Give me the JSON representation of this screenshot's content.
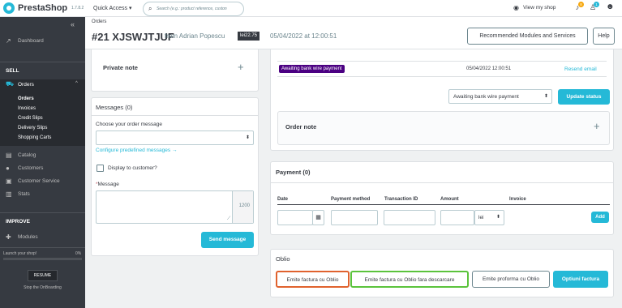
{
  "topbar": {
    "logo": "PrestaShop",
    "version": "1.7.8.2",
    "quick_access": "Quick Access ▾",
    "search_placeholder": "Search (e.g.: product reference, custon",
    "view_shop": "View my shop",
    "badge_orders": "8",
    "badge_customers": "1"
  },
  "sidebar": {
    "dashboard": "Dashboard",
    "sell": "SELL",
    "orders": "Orders",
    "orders_sub": [
      "Orders",
      "Invoices",
      "Credit Slips",
      "Delivery Slips",
      "Shopping Carts"
    ],
    "catalog": "Catalog",
    "customers": "Customers",
    "customer_service": "Customer Service",
    "stats": "Stats",
    "improve": "IMPROVE",
    "modules": "Modules",
    "launch": "Launch your shop!",
    "launch_pct": "0%",
    "launch_progress": 0,
    "resume": "RESUME",
    "stop_onboarding": "Stop the OnBoarding"
  },
  "header": {
    "breadcrumb": "Orders",
    "order_title": "#21 XJSWJTJUF",
    "from": "from Adrian Popescu",
    "total": "lei22.75",
    "date": "05/04/2022 at 12:00:51",
    "recommended": "Recommended Modules and Services",
    "help": "Help"
  },
  "private_note": {
    "title": "Private note"
  },
  "messages": {
    "title": "Messages (0)",
    "choose_label": "Choose your order message",
    "configure_link": "Configure predefined messages",
    "display_label": "Display to customer?",
    "message_label": "Message",
    "counter": "1200",
    "send": "Send message"
  },
  "status": {
    "status_badge": "Awaiting bank wire payment",
    "status_color": "#4b0082",
    "date": "05/04/2022 12:00:51",
    "resend": "Resend email",
    "select_value": "Awaiting bank wire payment",
    "update": "Update status"
  },
  "order_note": {
    "title": "Order note"
  },
  "payment": {
    "title": "Payment (0)",
    "columns": [
      "Date",
      "Payment method",
      "Transaction ID",
      "Amount",
      "Invoice"
    ],
    "currency": "lei",
    "add": "Add"
  },
  "oblio": {
    "title": "Oblio",
    "btn1": "Emite factura cu Oblio",
    "btn2": "Emite factura cu Oblio fara descarcare",
    "btn3": "Emite proforma cu Oblio",
    "btn4": "Optiuni factura"
  }
}
